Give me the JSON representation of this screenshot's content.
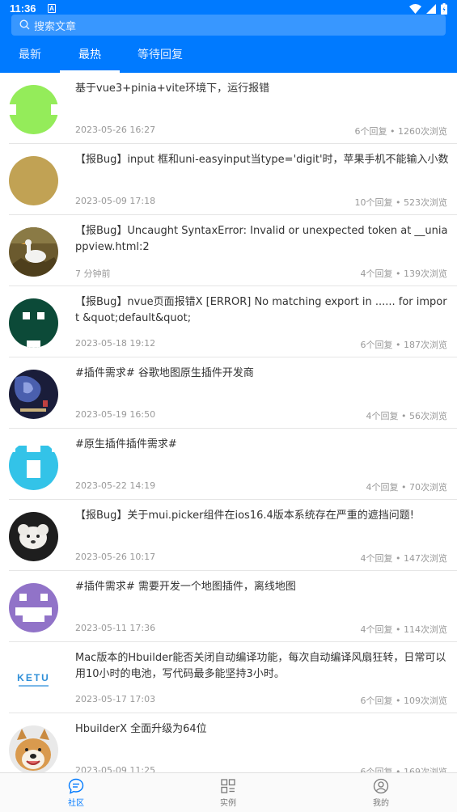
{
  "status_bar": {
    "time": "11:36",
    "notification_letter": "A"
  },
  "search": {
    "placeholder": "搜索文章"
  },
  "tabs": [
    {
      "label": "最新",
      "active": false
    },
    {
      "label": "最热",
      "active": true
    },
    {
      "label": "等待回复",
      "active": false
    }
  ],
  "articles": [
    {
      "title": "基于vue3+pinia+vite环境下，运行报错",
      "date": "2023-05-26 16:27",
      "stats": "6个回复 • 1260次浏览",
      "avatar": "green-pixel-avatar"
    },
    {
      "title": "【报Bug】input 框和uni-easyinput当type='digit'时，苹果手机不能输入小数",
      "date": "2023-05-09 17:18",
      "stats": "10个回复 • 523次浏览",
      "avatar": "plain-gold-avatar"
    },
    {
      "title": "【报Bug】Uncaught SyntaxError: Invalid or unexpected token at __uniappview.html:2",
      "date": "7 分钟前",
      "stats": "4个回复 • 139次浏览",
      "avatar": "goose-photo-avatar"
    },
    {
      "title": "【报Bug】nvue页面报错X [ERROR] No matching export in ...... for import &quot;default&quot;",
      "date": "2023-05-18 19:12",
      "stats": "6个回复 • 187次浏览",
      "avatar": "dark-green-pixel-avatar"
    },
    {
      "title": "#插件需求# 谷歌地图原生插件开发商",
      "date": "2023-05-19 16:50",
      "stats": "4个回复 • 56次浏览",
      "avatar": "blue-art-avatar"
    },
    {
      "title": "#原生插件插件需求#",
      "date": "2023-05-22 14:19",
      "stats": "4个回复 • 70次浏览",
      "avatar": "cyan-pixel-avatar"
    },
    {
      "title": "【报Bug】关于mui.picker组件在ios16.4版本系统存在严重的遮挡问题!",
      "date": "2023-05-26 10:17",
      "stats": "4个回复 • 147次浏览",
      "avatar": "dog-photo-avatar"
    },
    {
      "title": "#插件需求# 需要开发一个地图插件，离线地图",
      "date": "2023-05-11 17:36",
      "stats": "4个回复 • 114次浏览",
      "avatar": "purple-pixel-avatar"
    },
    {
      "title": "Mac版本的Hbuilder能否关闭自动编译功能，每次自动编译风扇狂转，日常可以用10小时的电池，写代码最多能坚持3小时。",
      "date": "2023-05-17 17:03",
      "stats": "6个回复 • 109次浏览",
      "avatar": "ketu-logo-avatar",
      "logo_text": "KETU"
    },
    {
      "title": "HbuilderX 全面升级为64位",
      "date": "2023-05-09 11:25",
      "stats": "6个回复 • 169次浏览",
      "avatar": "shiba-photo-avatar"
    }
  ],
  "bottom_nav": [
    {
      "label": "社区",
      "icon": "chat-icon",
      "active": true
    },
    {
      "label": "实例",
      "icon": "grid-icon",
      "active": false
    },
    {
      "label": "我的",
      "icon": "user-icon",
      "active": false
    }
  ],
  "colors": {
    "primary": "#007aff",
    "text": "#333333",
    "meta": "#999999"
  }
}
